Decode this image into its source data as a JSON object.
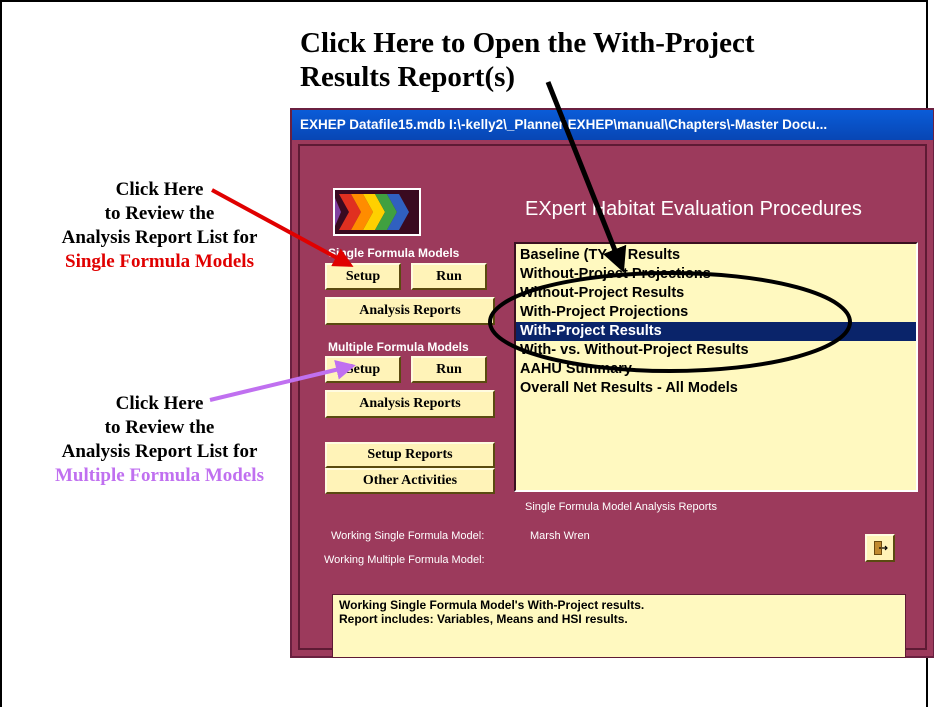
{
  "callouts": {
    "top_line1": "Click Here to Open the With-Project",
    "top_line2": "Results Report(s)",
    "left1_line1": "Click Here",
    "left1_line2": "to Review the",
    "left1_line3": "Analysis Report List for",
    "left1_line4": "Single Formula Models",
    "left2_line1": "Click Here",
    "left2_line2": "to Review the",
    "left2_line3": "Analysis Report List for",
    "left2_line4": "Multiple Formula Models"
  },
  "window": {
    "title": "EXHEP   Datafile15.mdb   I:\\-kelly2\\_Planner\\EXHEP\\manual\\Chapters\\-Master Docu..."
  },
  "app": {
    "heading": "EXpert Habitat Evaluation Procedures",
    "single_group_label": "Single Formula Models",
    "multi_group_label": "Multiple Formula Models",
    "setup_label": "Setup",
    "run_label": "Run",
    "analysis_reports_label": "Analysis Reports",
    "setup_reports_label": "Setup Reports",
    "other_activities_label": "Other Activities",
    "list_caption": "Single Formula Model Analysis Reports",
    "working_single_label": "Working Single Formula Model:",
    "working_single_value": "Marsh Wren",
    "working_multiple_label": "Working Multiple Formula Model:",
    "description_line1": "Working Single Formula Model's With-Project results.",
    "description_line2": "Report includes:  Variables, Means and HSI results."
  },
  "reports": [
    {
      "label": "Baseline (TY 0) Results",
      "selected": false
    },
    {
      "label": "Without-Project Projections",
      "selected": false
    },
    {
      "label": "Without-Project Results",
      "selected": false
    },
    {
      "label": "With-Project Projections",
      "selected": false
    },
    {
      "label": "With-Project Results",
      "selected": true
    },
    {
      "label": "With- vs. Without-Project Results",
      "selected": false
    },
    {
      "label": "AAHU Summary",
      "selected": false
    },
    {
      "label": "Overall Net Results - All Models",
      "selected": false
    }
  ],
  "colors": {
    "window_bg": "#9c3a5c",
    "button_bg": "#fff3b8",
    "list_bg": "#fff9c0",
    "selection": "#0a246a",
    "red_text": "#e00000",
    "purple_text": "#c070f0"
  },
  "icons": {
    "exit": "exit-door-icon",
    "logo": "chevron-arrows-logo"
  }
}
